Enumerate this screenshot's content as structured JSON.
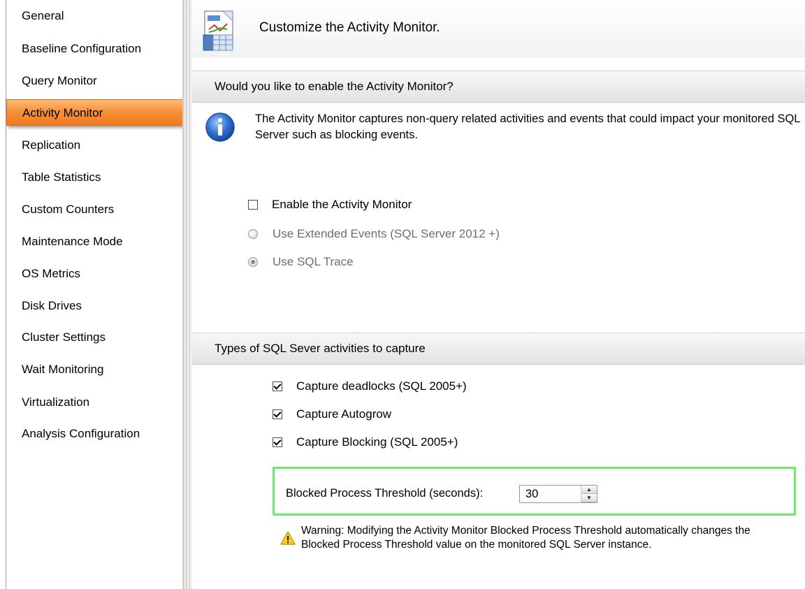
{
  "sidebar": {
    "items": [
      {
        "label": "General"
      },
      {
        "label": "Baseline Configuration"
      },
      {
        "label": "Query Monitor"
      },
      {
        "label": "Activity Monitor",
        "active": true
      },
      {
        "label": "Replication"
      },
      {
        "label": "Table Statistics"
      },
      {
        "label": "Custom Counters"
      },
      {
        "label": "Maintenance Mode"
      },
      {
        "label": "OS Metrics"
      },
      {
        "label": "Disk Drives"
      },
      {
        "label": "Cluster Settings"
      },
      {
        "label": "Wait Monitoring"
      },
      {
        "label": "Virtualization"
      },
      {
        "label": "Analysis Configuration"
      }
    ]
  },
  "header": {
    "title": "Customize the Activity Monitor.",
    "icon": "activity-monitor-icon"
  },
  "enable_section": {
    "heading": "Would you like to enable the Activity Monitor?",
    "info_icon": "info-icon",
    "info_text": "The Activity Monitor captures non-query related activities and events that could impact your monitored SQL Server such as blocking events.",
    "enable_checkbox": {
      "label": "Enable the Activity Monitor",
      "checked": false
    },
    "radio_extended": {
      "label": "Use Extended Events (SQL Server 2012 +)",
      "selected": false,
      "disabled": true
    },
    "radio_trace": {
      "label": "Use SQL Trace",
      "selected": true,
      "disabled": true
    }
  },
  "capture_section": {
    "heading": "Types of SQL Sever activities to capture",
    "options": [
      {
        "label": "Capture deadlocks (SQL 2005+)",
        "checked": true
      },
      {
        "label": "Capture Autogrow",
        "checked": true
      },
      {
        "label": "Capture Blocking (SQL 2005+)",
        "checked": true
      }
    ],
    "threshold": {
      "label": "Blocked Process Threshold (seconds):",
      "value": "30",
      "highlight_color": "#6ee86a"
    },
    "warning_icon": "warning-icon",
    "warning_text": "Warning: Modifying the Activity Monitor Blocked Process Threshold automatically changes the Blocked Process Threshold value on the monitored SQL Server instance."
  },
  "colors": {
    "active_nav": "#f7923c",
    "highlight": "#6ee86a"
  }
}
